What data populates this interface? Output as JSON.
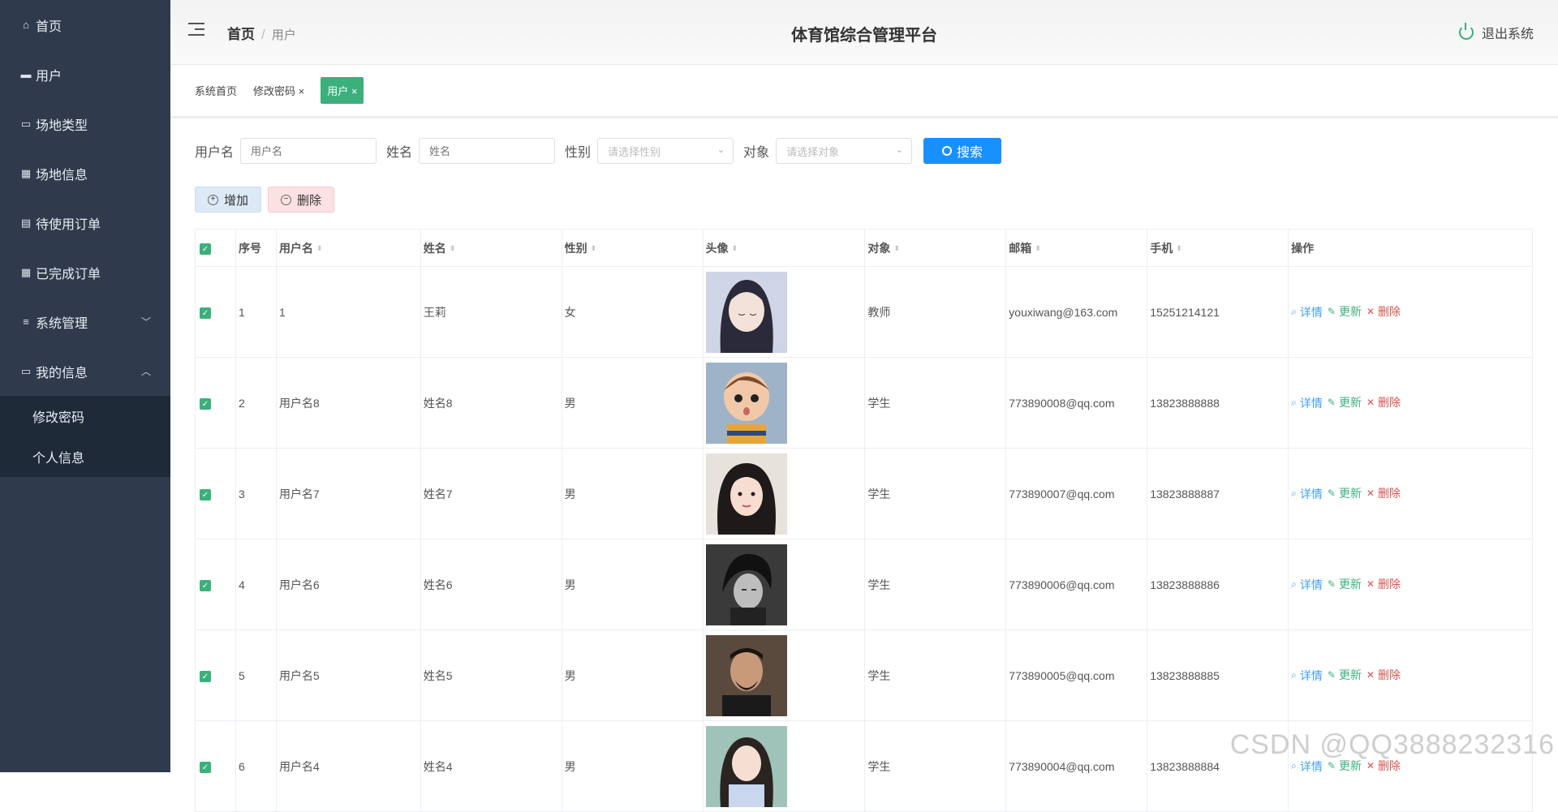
{
  "sidebar": {
    "items": [
      {
        "label": "首页",
        "icon": "home-icon"
      },
      {
        "label": "用户",
        "icon": "chat-icon"
      },
      {
        "label": "场地类型",
        "icon": "monitor-icon"
      },
      {
        "label": "场地信息",
        "icon": "grid-icon"
      },
      {
        "label": "待使用订单",
        "icon": "briefcase-icon"
      },
      {
        "label": "已完成订单",
        "icon": "grid-icon"
      },
      {
        "label": "系统管理",
        "icon": "sliders-icon",
        "arrow": "chevron-down"
      },
      {
        "label": "我的信息",
        "icon": "card-icon",
        "arrow": "chevron-up"
      }
    ],
    "sub_items": [
      {
        "label": "修改密码"
      },
      {
        "label": "个人信息"
      }
    ]
  },
  "header": {
    "breadcrumb_home": "首页",
    "breadcrumb_current": "用户",
    "title": "体育馆综合管理平台",
    "logout_label": "退出系统"
  },
  "tags": [
    {
      "label": "系统首页"
    },
    {
      "label": "修改密码 ×"
    },
    {
      "label": "用户 ×",
      "active": true
    }
  ],
  "search": {
    "username_label": "用户名",
    "username_placeholder": "用户名",
    "name_label": "姓名",
    "name_placeholder": "姓名",
    "gender_label": "性别",
    "gender_placeholder": "请选择性别",
    "target_label": "对象",
    "target_placeholder": "请选择对象",
    "button_label": "搜索"
  },
  "actions": {
    "add_label": "增加",
    "delete_label": "删除"
  },
  "table": {
    "headers": [
      "序号",
      "用户名",
      "姓名",
      "性别",
      "头像",
      "对象",
      "邮箱",
      "手机",
      "操作"
    ],
    "op_labels": {
      "detail": "详情",
      "update": "更新",
      "delete": "删除"
    },
    "rows": [
      {
        "no": "1",
        "username": "1",
        "name": "王莉",
        "gender": "女",
        "target": "教师",
        "email": "youxiwang@163.com",
        "phone": "15251214121"
      },
      {
        "no": "2",
        "username": "用户名8",
        "name": "姓名8",
        "gender": "男",
        "target": "学生",
        "email": "773890008@qq.com",
        "phone": "13823888888"
      },
      {
        "no": "3",
        "username": "用户名7",
        "name": "姓名7",
        "gender": "男",
        "target": "学生",
        "email": "773890007@qq.com",
        "phone": "13823888887"
      },
      {
        "no": "4",
        "username": "用户名6",
        "name": "姓名6",
        "gender": "男",
        "target": "学生",
        "email": "773890006@qq.com",
        "phone": "13823888886"
      },
      {
        "no": "5",
        "username": "用户名5",
        "name": "姓名5",
        "gender": "男",
        "target": "学生",
        "email": "773890005@qq.com",
        "phone": "13823888885"
      },
      {
        "no": "6",
        "username": "用户名4",
        "name": "姓名4",
        "gender": "男",
        "target": "学生",
        "email": "773890004@qq.com",
        "phone": "13823888884"
      }
    ]
  },
  "watermark": "CSDN @QQ3888232316",
  "colors": {
    "sidebar": "#2f3b4c",
    "accent": "#3cb07c",
    "primary": "#1890ff"
  }
}
